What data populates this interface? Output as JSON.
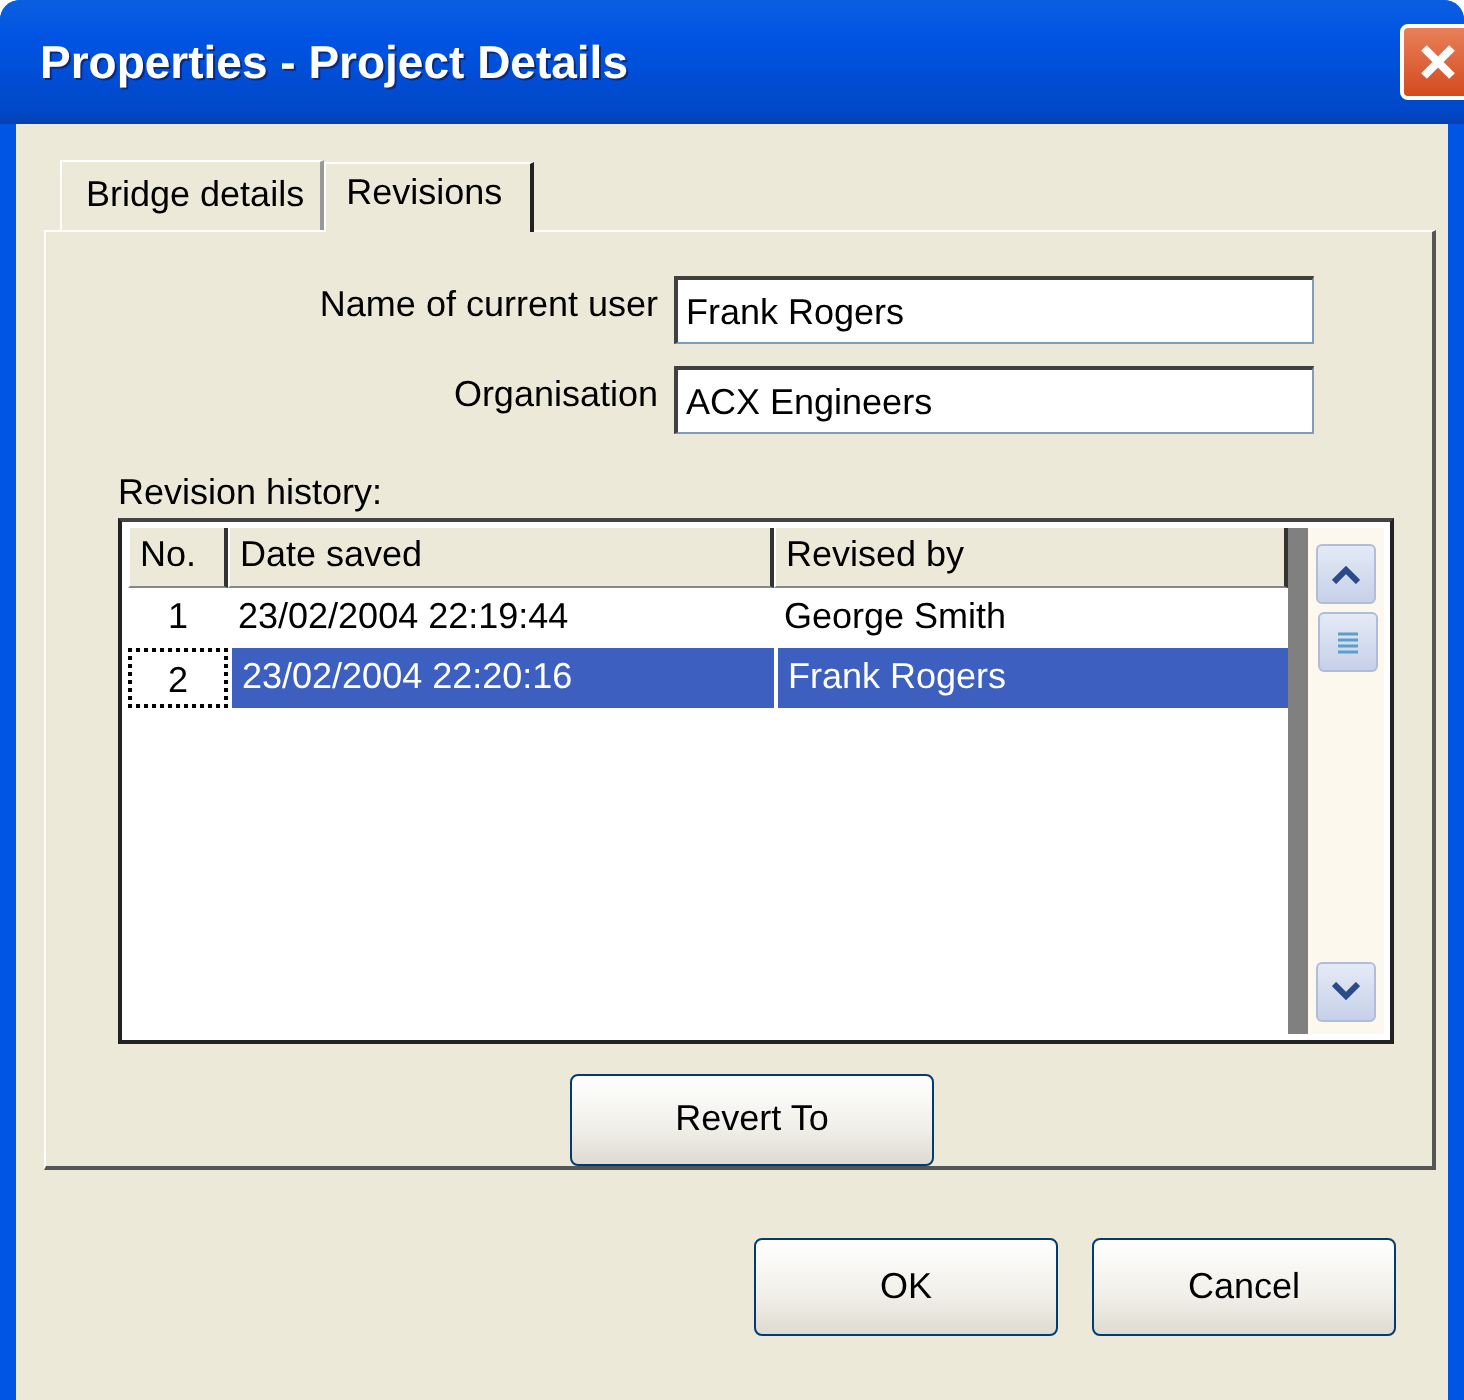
{
  "window": {
    "title": "Properties - Project Details"
  },
  "tabs": [
    {
      "label": "Bridge details",
      "selected": false
    },
    {
      "label": "Revisions",
      "selected": true
    }
  ],
  "fields": [
    {
      "label": "Name of current user",
      "value": "Frank Rogers"
    },
    {
      "label": "Organisation",
      "value": "ACX Engineers"
    }
  ],
  "revision_history": {
    "label": "Revision history:",
    "columns": [
      "No.",
      "Date saved",
      "Revised by"
    ],
    "rows": [
      {
        "cells": [
          "1",
          "23/02/2004 22:19:44",
          "George Smith"
        ],
        "selected": false
      },
      {
        "cells": [
          "2",
          "23/02/2004 22:20:16",
          "Frank Rogers"
        ],
        "selected": true
      }
    ]
  },
  "revert_button": "Revert To",
  "buttons": [
    "OK",
    "Cancel"
  ]
}
